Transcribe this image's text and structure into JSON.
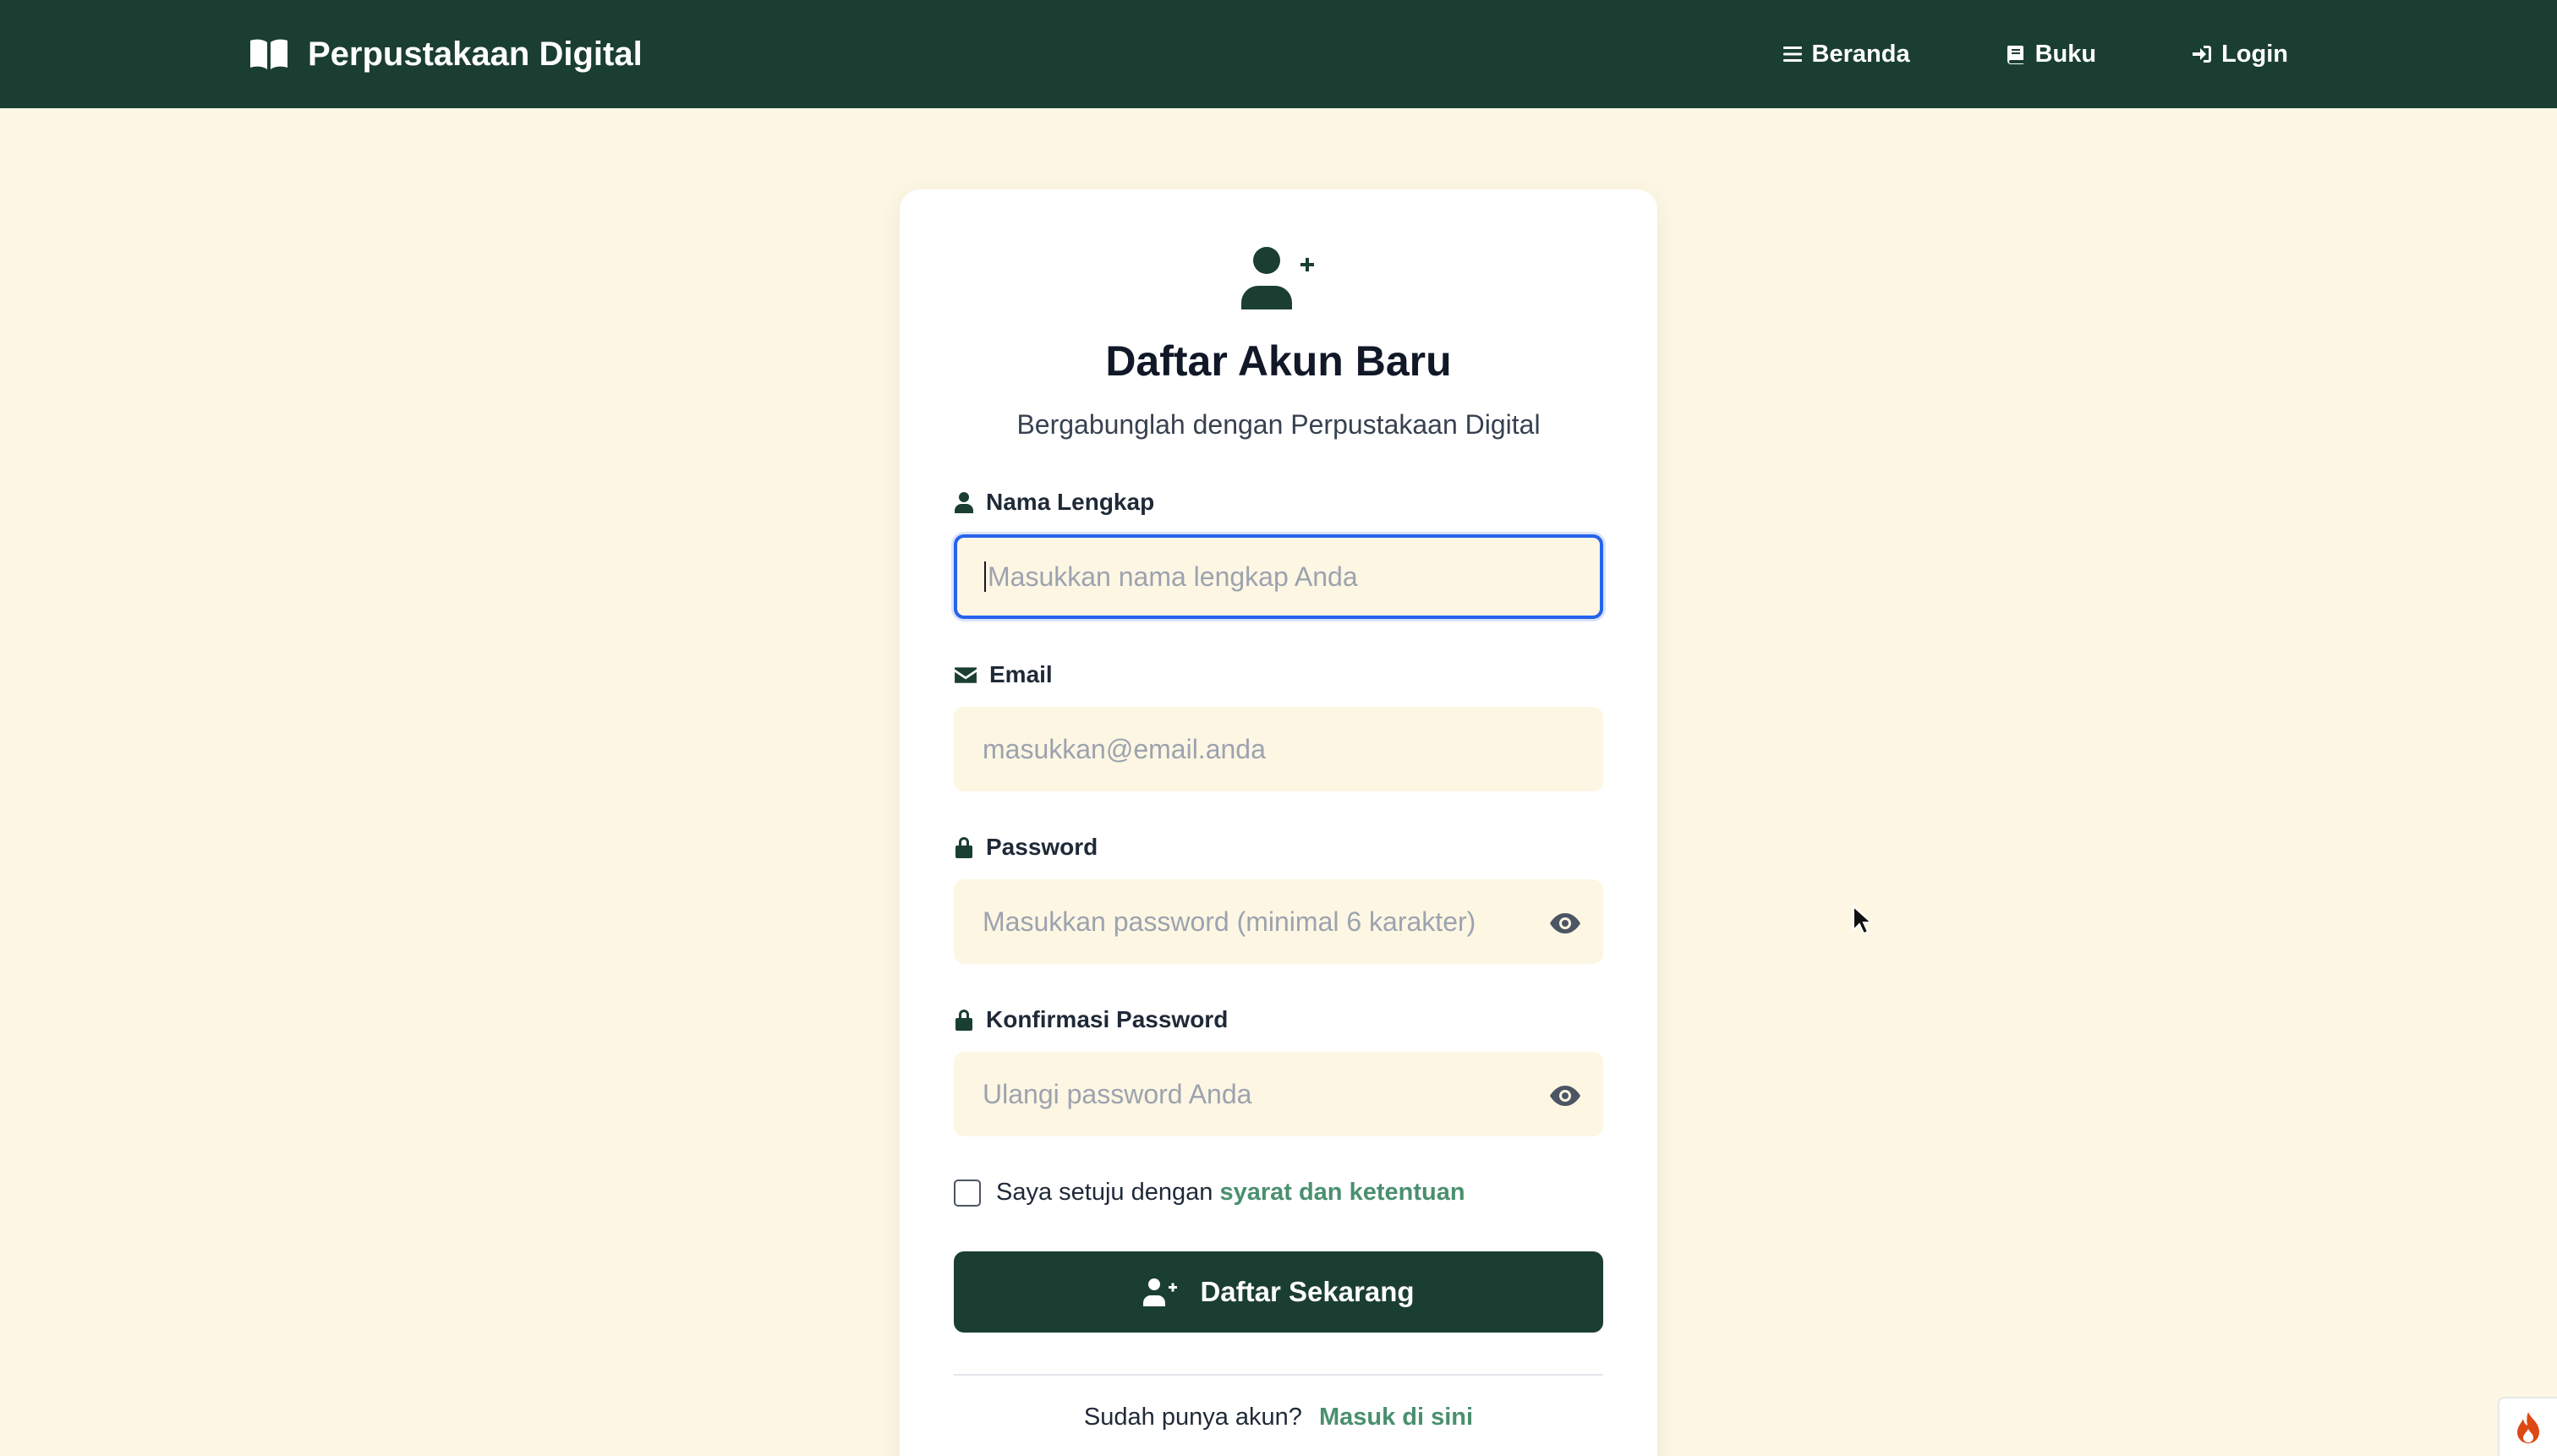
{
  "navbar": {
    "brand": "Perpustakaan Digital",
    "links": [
      {
        "label": "Beranda",
        "icon": "bars-icon"
      },
      {
        "label": "Buku",
        "icon": "book-icon"
      },
      {
        "label": "Login",
        "icon": "sign-in-icon"
      }
    ]
  },
  "form": {
    "icon": "user-plus-icon",
    "title": "Daftar Akun Baru",
    "subtitle": "Bergabunglah dengan Perpustakaan Digital",
    "fields": [
      {
        "label": "Nama Lengkap",
        "placeholder": "Masukkan nama lengkap Anda",
        "value": "",
        "icon": "user-icon"
      },
      {
        "label": "Email",
        "placeholder": "masukkan@email.anda",
        "value": "",
        "icon": "envelope-icon"
      },
      {
        "label": "Password",
        "placeholder": "Masukkan password (minimal 6 karakter)",
        "value": "",
        "icon": "lock-icon"
      },
      {
        "label": "Konfirmasi Password",
        "placeholder": "Ulangi password Anda",
        "value": "",
        "icon": "lock-icon"
      }
    ],
    "terms_prefix": "Saya setuju dengan",
    "terms_link": "syarat dan ketentuan",
    "terms_checked": false,
    "submit_label": "Daftar Sekarang",
    "login_prompt": "Sudah punya akun?",
    "login_link": "Masuk di sini"
  },
  "colors": {
    "primary": "#1b3e33",
    "background": "#fdf6e3",
    "link": "#4a8f6e",
    "focus": "#2563eb"
  }
}
